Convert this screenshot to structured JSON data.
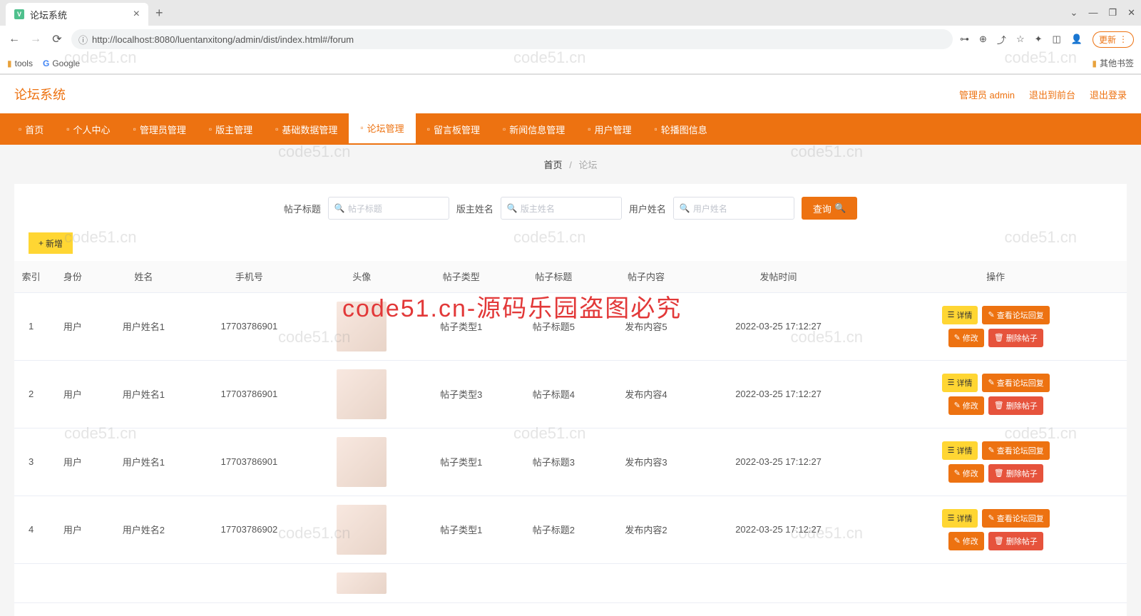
{
  "browser": {
    "tab_title": "论坛系统",
    "url": "http://localhost:8080/luentanxitong/admin/dist/index.html#/forum",
    "update_label": "更新",
    "bookmarks": [
      {
        "icon": "folder",
        "label": "tools"
      },
      {
        "icon": "google",
        "label": "Google"
      }
    ],
    "other_bookmarks": "其他书签"
  },
  "header": {
    "app_title": "论坛系统",
    "admin_label": "管理员 admin",
    "exit_front": "退出到前台",
    "logout": "退出登录"
  },
  "menu": [
    {
      "icon": "home",
      "label": "首页"
    },
    {
      "icon": "user",
      "label": "个人中心"
    },
    {
      "icon": "admin",
      "label": "管理员管理"
    },
    {
      "icon": "owner",
      "label": "版主管理"
    },
    {
      "icon": "data",
      "label": "基础数据管理"
    },
    {
      "icon": "forum",
      "label": "论坛管理",
      "active": true
    },
    {
      "icon": "board",
      "label": "留言板管理"
    },
    {
      "icon": "news",
      "label": "新闻信息管理"
    },
    {
      "icon": "users",
      "label": "用户管理"
    },
    {
      "icon": "carousel",
      "label": "轮播图信息"
    }
  ],
  "breadcrumb": {
    "home": "首页",
    "current": "论坛"
  },
  "search": {
    "f1_label": "帖子标题",
    "f1_ph": "帖子标题",
    "f2_label": "版主姓名",
    "f2_ph": "版主姓名",
    "f3_label": "用户姓名",
    "f3_ph": "用户姓名",
    "query_btn": "查询"
  },
  "toolbar": {
    "add_btn": "新增"
  },
  "table": {
    "headers": [
      "索引",
      "身份",
      "姓名",
      "手机号",
      "头像",
      "帖子类型",
      "帖子标题",
      "帖子内容",
      "发帖时间",
      "操作"
    ],
    "rows": [
      {
        "idx": "1",
        "role": "用户",
        "name": "用户姓名1",
        "phone": "17703786901",
        "type": "帖子类型1",
        "title": "帖子标题5",
        "content": "发布内容5",
        "time": "2022-03-25 17:12:27"
      },
      {
        "idx": "2",
        "role": "用户",
        "name": "用户姓名1",
        "phone": "17703786901",
        "type": "帖子类型3",
        "title": "帖子标题4",
        "content": "发布内容4",
        "time": "2022-03-25 17:12:27"
      },
      {
        "idx": "3",
        "role": "用户",
        "name": "用户姓名1",
        "phone": "17703786901",
        "type": "帖子类型1",
        "title": "帖子标题3",
        "content": "发布内容3",
        "time": "2022-03-25 17:12:27"
      },
      {
        "idx": "4",
        "role": "用户",
        "name": "用户姓名2",
        "phone": "17703786902",
        "type": "帖子类型1",
        "title": "帖子标题2",
        "content": "发布内容2",
        "time": "2022-03-25 17:12:27"
      }
    ],
    "ops": {
      "detail": "详情",
      "reply": "查看论坛回复",
      "edit": "修改",
      "del": "删除帖子"
    }
  },
  "watermark": {
    "text": "code51.cn",
    "red": "code51.cn-源码乐园盗图必究"
  }
}
